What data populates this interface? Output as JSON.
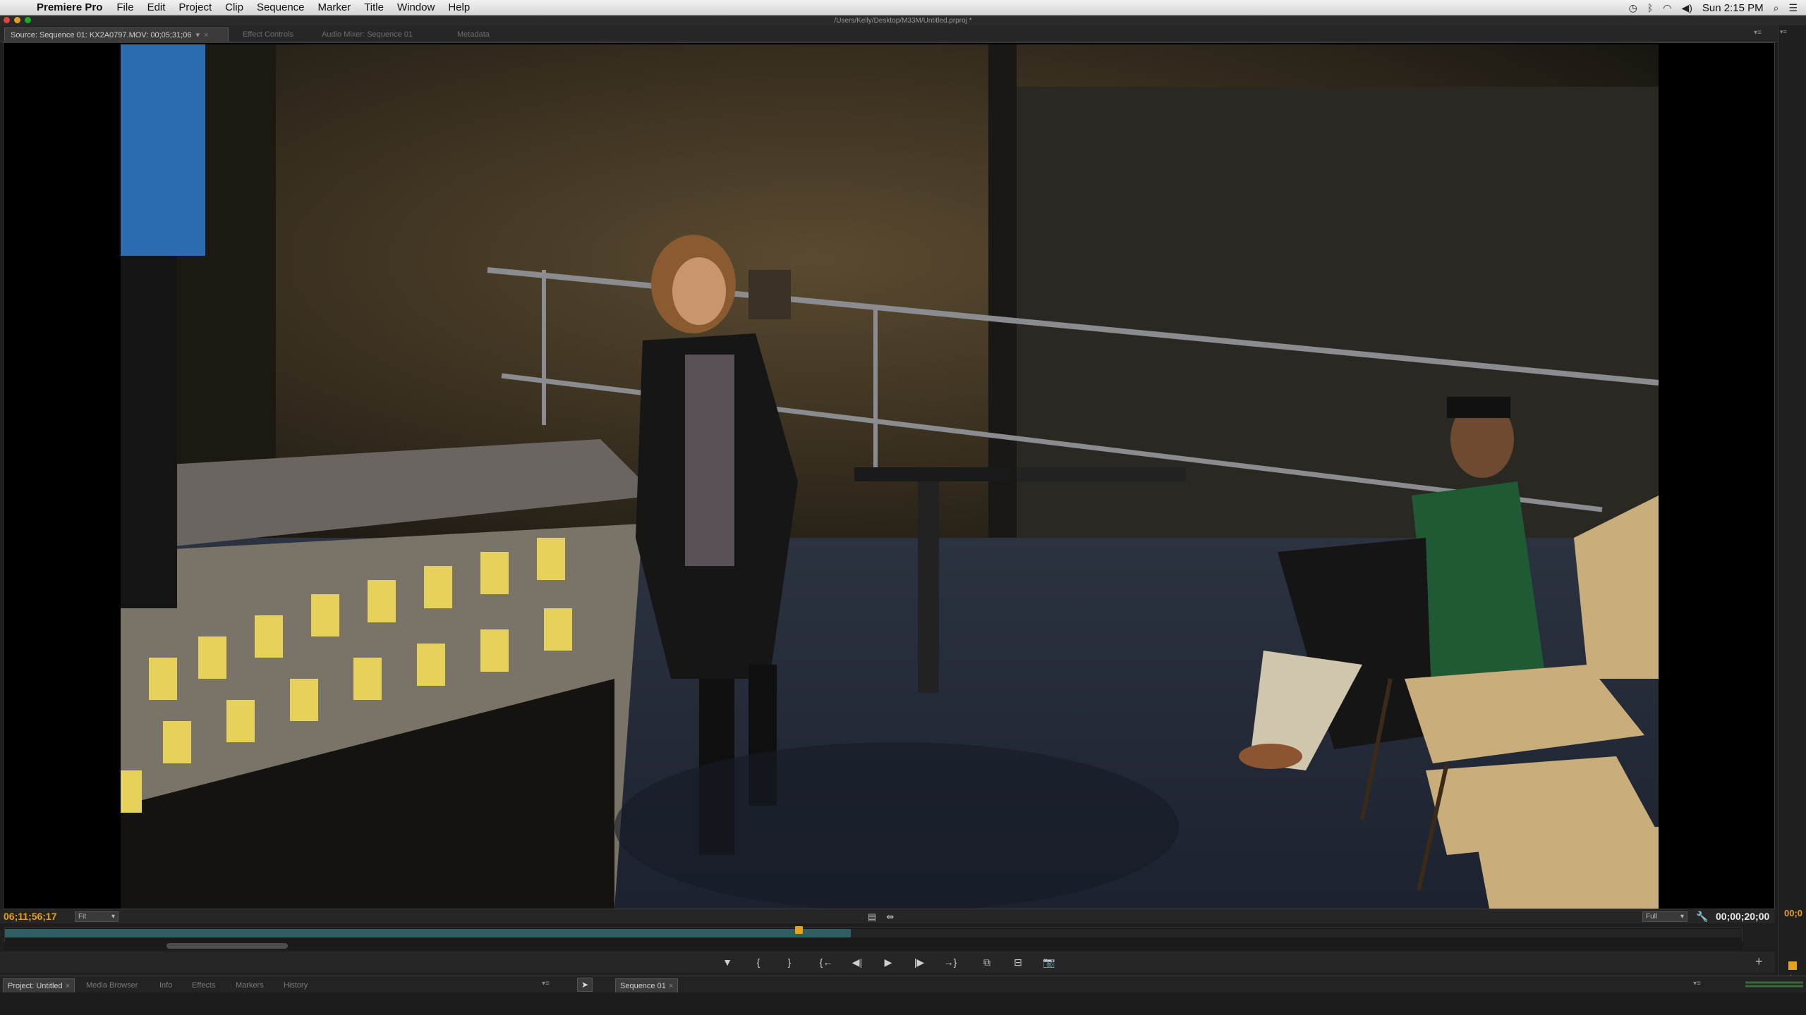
{
  "menubar": {
    "app_name": "Premiere Pro",
    "items": [
      "File",
      "Edit",
      "Project",
      "Clip",
      "Sequence",
      "Marker",
      "Title",
      "Window",
      "Help"
    ],
    "clock": "Sun 2:15 PM"
  },
  "window": {
    "title": "/Users/Kelly/Desktop/M33M/Untitled.prproj *"
  },
  "panel_tabs": {
    "source": "Source: Sequence 01: KX2A0797.MOV: 00;05;31;06",
    "effect_controls": "Effect Controls",
    "audio_mixer": "Audio Mixer: Sequence 01",
    "metadata": "Metadata"
  },
  "monitor": {
    "current_timecode": "06;11;56;17",
    "fit_label": "Fit",
    "resolution_label": "Full",
    "duration_timecode": "00;00;20;00",
    "right_edge_timecode": "00;0",
    "playhead_position": 0.455,
    "played_fraction": 0.487
  },
  "transport": {
    "buttons": [
      {
        "name": "add-marker",
        "glyph": "▼"
      },
      {
        "name": "mark-in",
        "glyph": "{"
      },
      {
        "name": "mark-out",
        "glyph": "}"
      },
      {
        "name": "go-to-in",
        "glyph": "{←"
      },
      {
        "name": "step-back",
        "glyph": "◀|"
      },
      {
        "name": "play",
        "glyph": "▶"
      },
      {
        "name": "step-forward",
        "glyph": "|▶"
      },
      {
        "name": "go-to-out",
        "glyph": "→}"
      },
      {
        "name": "insert",
        "glyph": "⧉"
      },
      {
        "name": "overwrite",
        "glyph": "⊟"
      },
      {
        "name": "export-frame",
        "glyph": "📷"
      }
    ]
  },
  "bottom_tabs": {
    "project": "Project: Untitled",
    "media_browser": "Media Browser",
    "info": "Info",
    "effects": "Effects",
    "markers": "Markers",
    "history": "History",
    "sequence": "Sequence 01"
  },
  "colors": {
    "timecode_accent": "#e8a01a",
    "scrub_fill": "#2e5d62",
    "panel_bg": "#262626"
  }
}
